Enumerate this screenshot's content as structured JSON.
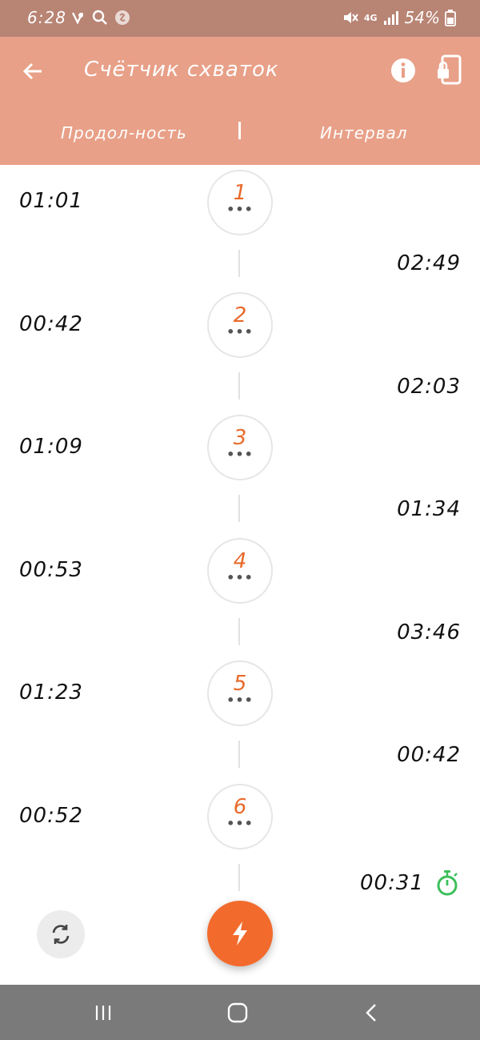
{
  "status_bar": {
    "time": "6:28",
    "battery": "54%",
    "network": "4G"
  },
  "app_bar": {
    "title": "Счётчик схваток",
    "column_duration": "Продол-ность",
    "column_interval": "Интервал"
  },
  "contractions": [
    {
      "number": "1",
      "duration": "01:01",
      "interval": "02:49",
      "menu": "•••"
    },
    {
      "number": "2",
      "duration": "00:42",
      "interval": "02:03",
      "menu": "•••"
    },
    {
      "number": "3",
      "duration": "01:09",
      "interval": "01:34",
      "menu": "•••"
    },
    {
      "number": "4",
      "duration": "00:53",
      "interval": "03:46",
      "menu": "•••"
    },
    {
      "number": "5",
      "duration": "01:23",
      "interval": "00:42",
      "menu": "•••"
    },
    {
      "number": "6",
      "duration": "00:52",
      "menu": "•••"
    }
  ],
  "live_interval": "00:31",
  "icons": {
    "back": "arrow-left-icon",
    "info": "info-icon",
    "lock": "screen-lock-icon",
    "stopwatch": "stopwatch-icon",
    "reset": "refresh-icon",
    "start": "lightning-icon",
    "nav_recent": "recent-apps-icon",
    "nav_home": "home-icon",
    "nav_back": "chevron-left-icon"
  },
  "colors": {
    "status_bar": "#b88474",
    "app_bar": "#e8a088",
    "accent": "#f26b2c",
    "number_text": "#e8692a",
    "stopwatch": "#3cbf5a",
    "nav_bar": "#7a7a7a"
  }
}
